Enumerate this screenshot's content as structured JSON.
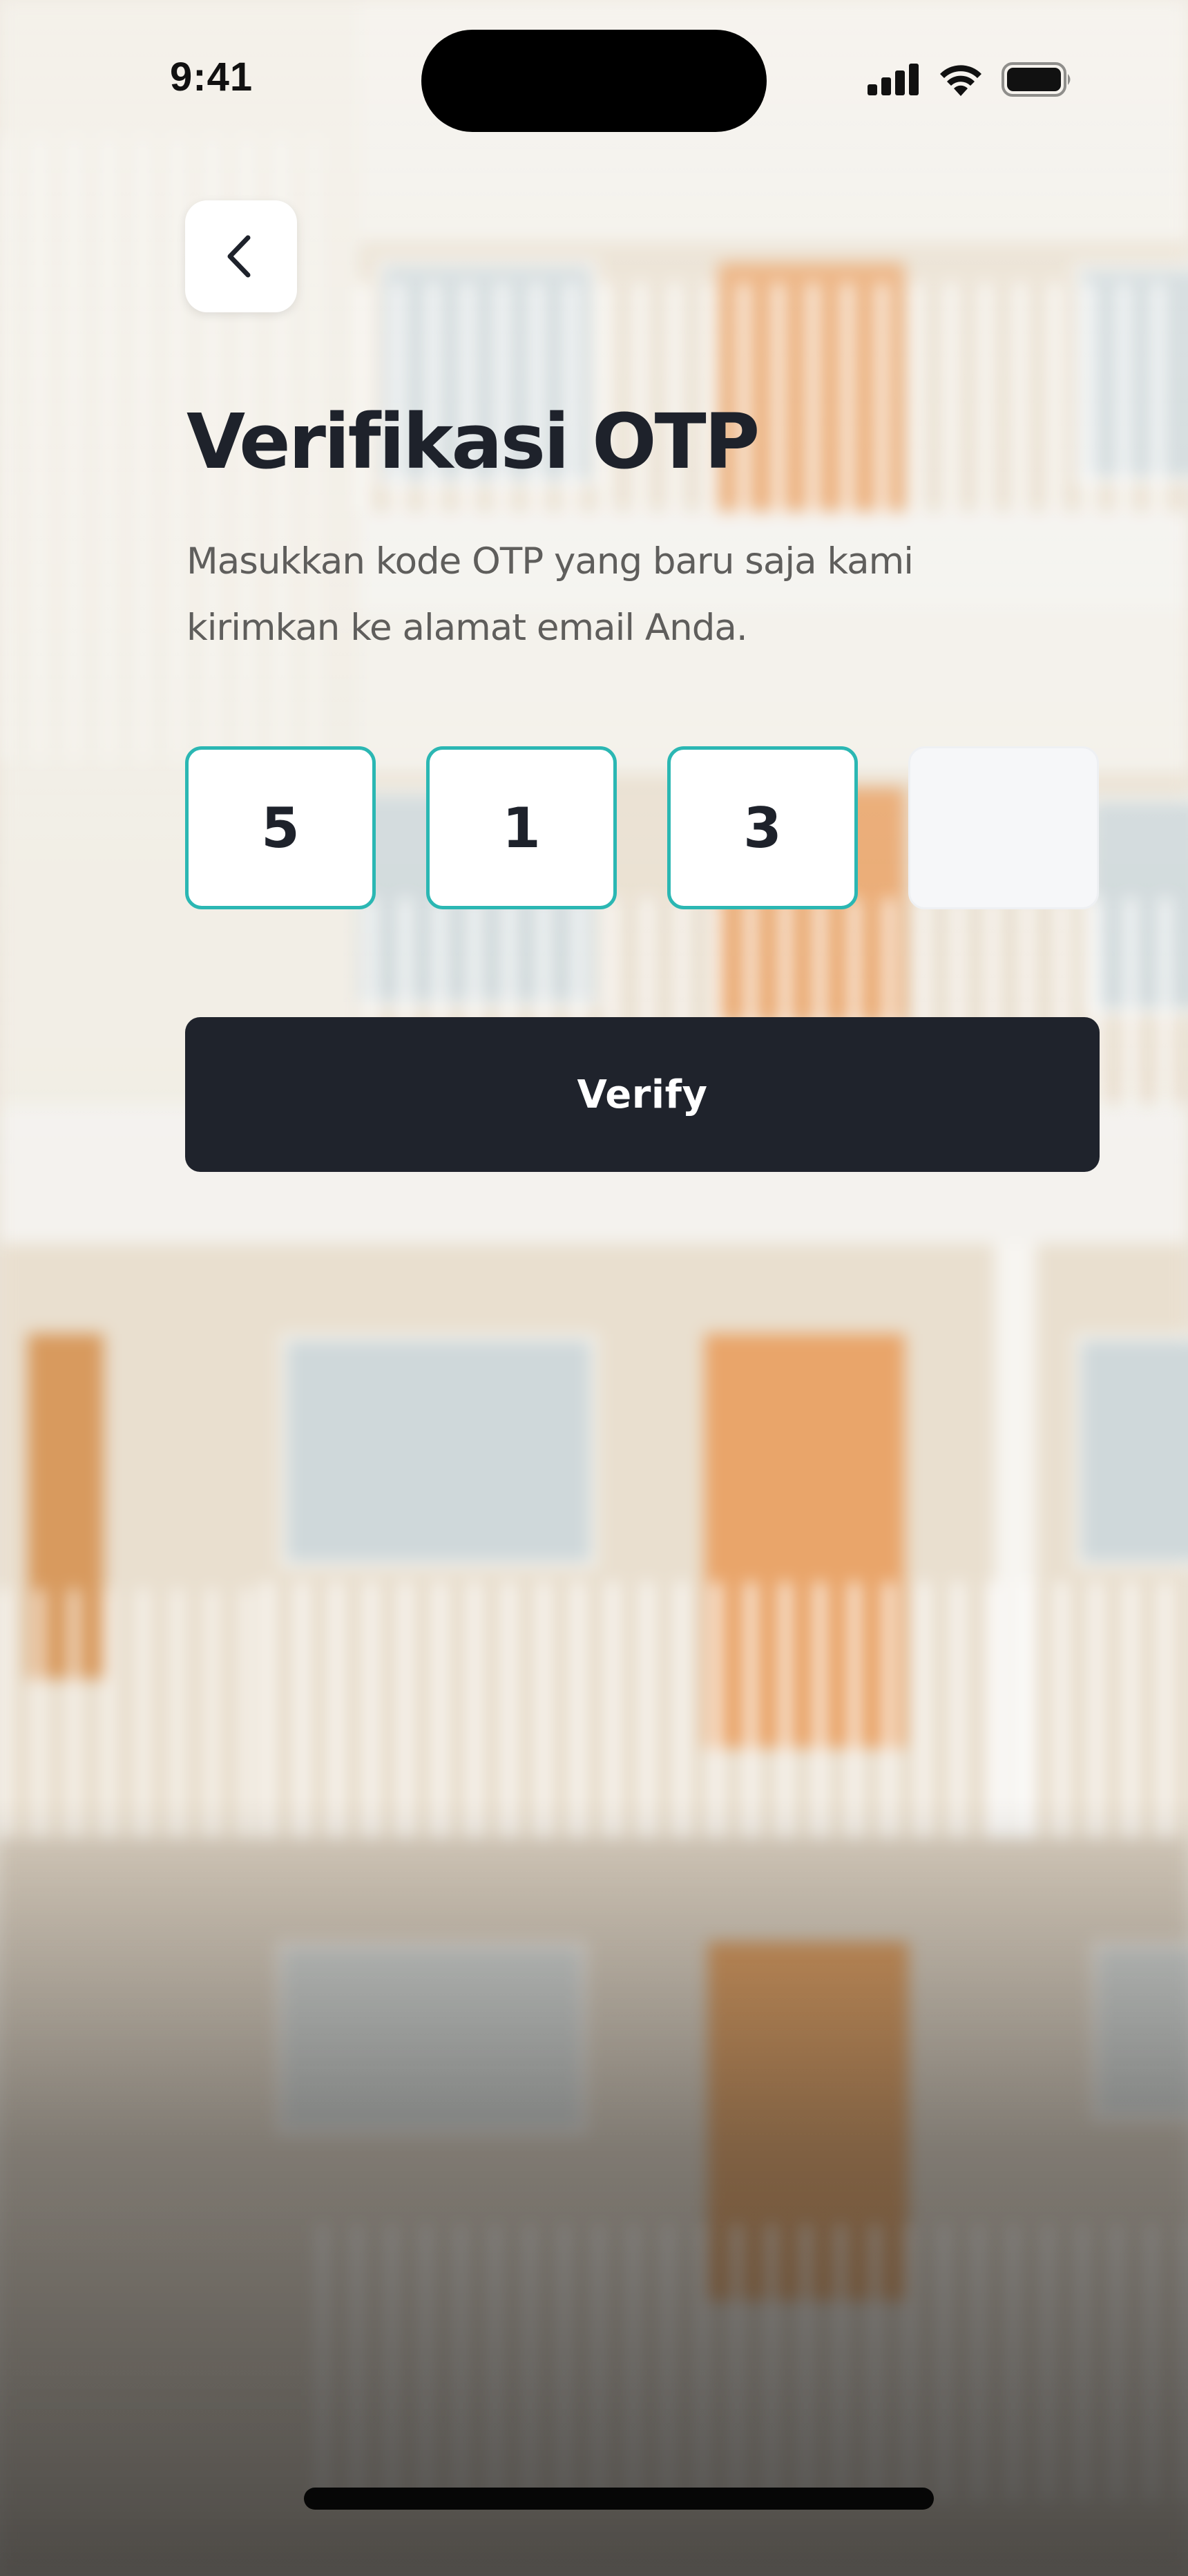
{
  "status_bar": {
    "time": "9:41"
  },
  "header": {
    "back_icon": "chevron-left-icon",
    "title": "Verifikasi OTP",
    "subtitle": "Masukkan kode OTP yang baru saja kami kirimkan ke alamat email Anda."
  },
  "otp": {
    "digits": [
      "5",
      "1",
      "3",
      ""
    ],
    "filled_border_color": "#2bb7b3",
    "empty_fill_color": "#f6f7f9"
  },
  "actions": {
    "verify_label": "Verify",
    "verify_color": "#1f232c"
  },
  "colors": {
    "title": "#1e222b",
    "subtitle": "#5f5e5c"
  }
}
